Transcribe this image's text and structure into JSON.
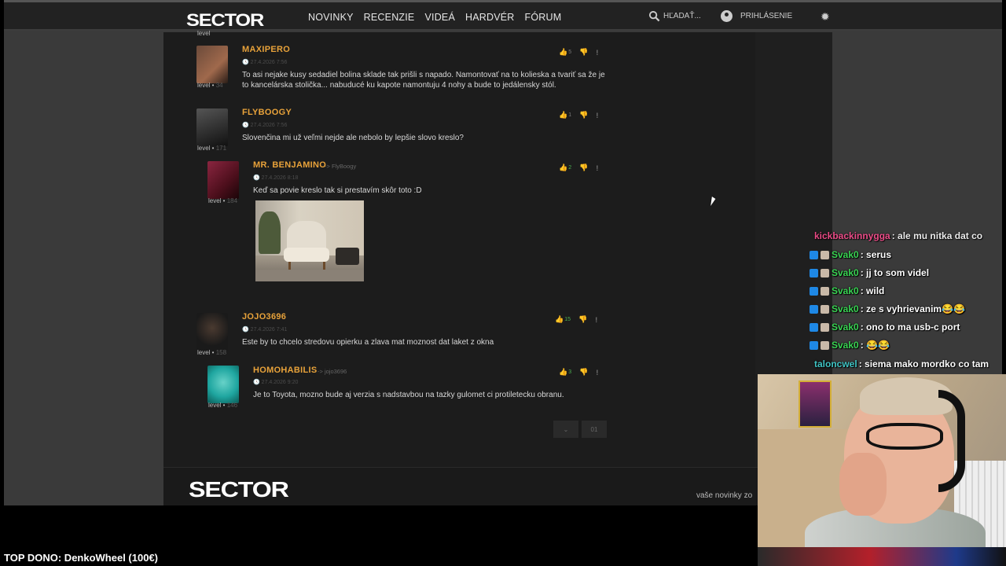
{
  "site": {
    "logo": "SECTOR",
    "nav": [
      "NOVINKY",
      "RECENZIE",
      "VIDEÁ",
      "HARDVÉR",
      "FÓRUM"
    ],
    "search_label": "HĽADAŤ...",
    "login_label": "PRIHLÁSENIE"
  },
  "top_partial": {
    "level_label": "level"
  },
  "comments": [
    {
      "username": "MAXIPERO",
      "reply_to": "",
      "date": "27.4.2026 7:56",
      "level_label": "level",
      "level": "34",
      "text": "To asi nejake kusy sedadiel bolina sklade tak prišli s napado. Namontovať na to kolieska a tvariť sa že je to kancelárska stolička... nabuducé ku kapote namontuju 4 nohy a bude to jedálensky stól.",
      "likes": "5",
      "avatar_colors": [
        "#6b4a3a",
        "#a0694c"
      ]
    },
    {
      "username": "FLYBOOGY",
      "reply_to": "",
      "date": "27.4.2026 7:56",
      "level_label": "level",
      "level": "171",
      "text": "Slovenčina mi už veľmi nejde ale nebolo by lepšie slovo kreslo?",
      "likes": "1",
      "avatar_colors": [
        "#2c2c2c",
        "#555555"
      ]
    },
    {
      "username": "MR. BENJAMINO",
      "reply_to": "-> FlyBoogy",
      "date": "27.4.2026 8:18",
      "level_label": "level",
      "level": "184",
      "text": "Keď sa povie kreslo tak si prestavím skôr toto :D",
      "likes": "2",
      "avatar_colors": [
        "#4d0f1c",
        "#8a2540"
      ]
    },
    {
      "username": "JOJO3696",
      "reply_to": "",
      "date": "27.4.2026 7:41",
      "level_label": "level",
      "level": "158",
      "text": "Este by to chcelo stredovu opierku a zlava mat moznost dat laket z okna",
      "likes": "15",
      "avatar_colors": [
        "#1a1a1a",
        "#4a3a30"
      ]
    },
    {
      "username": "HOMOHABILIS",
      "reply_to": "-> jojo3696",
      "date": "27.4.2026 9:20",
      "level_label": "level",
      "level": "146",
      "text": "Je to Toyota, mozno bude aj verzia s nadstavbou na tazky gulomet ci protiletecku obranu.",
      "likes": "3",
      "avatar_colors": [
        "#1fa6a0",
        "#67d2c8"
      ]
    }
  ],
  "pager": {
    "expand": "⌄",
    "page": "01"
  },
  "footer": {
    "logo": "SECTOR",
    "text": "vaše novinky zo"
  },
  "chat": [
    {
      "user": "kickbackinnygga",
      "message": ": ale mu nitka dat co",
      "color": "pink"
    },
    {
      "user": "Svak0",
      "message": ": serus",
      "color": "green"
    },
    {
      "user": "Svak0",
      "message": ": jj to som videl",
      "color": "green"
    },
    {
      "user": "Svak0",
      "message": ": wild",
      "color": "green"
    },
    {
      "user": "Svak0",
      "message": ": ze s vyhrievanim😂😂",
      "color": "green"
    },
    {
      "user": "Svak0",
      "message": ": ono to ma usb-c port",
      "color": "green"
    },
    {
      "user": "Svak0",
      "message": ": 😂😂",
      "color": "green"
    },
    {
      "user": "taloncwel",
      "message": ": siema mako mordko co tam",
      "color": "teal"
    }
  ],
  "top_dono": "TOP DONO: DenkoWheel (100€)",
  "colors": {
    "accent": "#e8a23a",
    "page_bg": "#3a3a3a",
    "content_bg": "#1c1c1c",
    "header_bg": "#222222"
  }
}
